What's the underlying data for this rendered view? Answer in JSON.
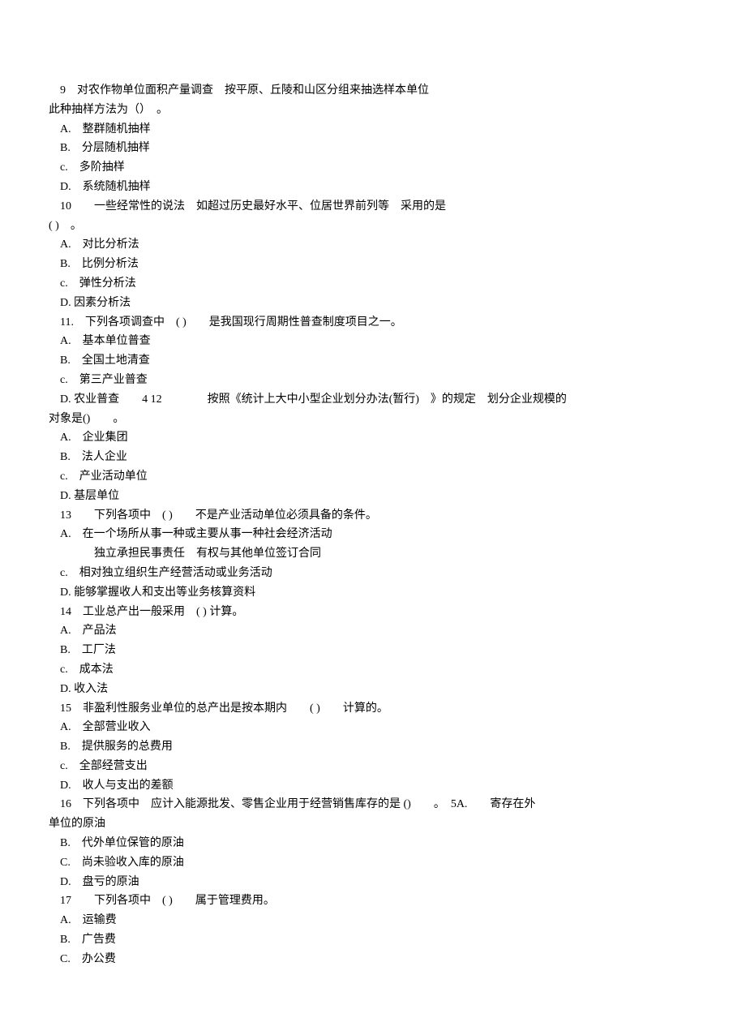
{
  "questions": [
    {
      "num": "9",
      "text": "对农作物单位面积产量调查　按平原、丘陵和山区分组来抽选样本单位",
      "text2": "此种抽样方法为（）　。",
      "options": [
        "A.　整群随机抽样",
        "B.　分层随机抽样",
        "c.　多阶抽样",
        "D.　系统随机抽样"
      ]
    },
    {
      "num": "10",
      "text": "　　一些经常性的说法　如超过历史最好水平、位居世界前列等　采用的是",
      "text2": "( )　。",
      "options": [
        "A.　对比分析法",
        "B.　比例分析法",
        "c.　弹性分析法",
        "D. 因素分析法"
      ]
    },
    {
      "num": "11.",
      "text": "　下列各项调查中　( )　　是我国现行周期性普查制度项目之一。",
      "options": [
        "A.　基本单位普查",
        "B.　全国土地清查",
        "c.　第三产业普查"
      ],
      "lastOption": "D. 农业普查　　4 12　　　　按照《统计上大中小型企业划分办法(暂行)　》的规定　划分企业规模的",
      "text3": "对象是()　　。",
      "options2": [
        "A.　企业集团",
        "B.　法人企业",
        "c.　产业活动单位",
        "D. 基层单位"
      ]
    },
    {
      "num": "13",
      "text": "　　下列各项中　( )　　不是产业活动单位必须具备的条件。",
      "options": [
        "A.　在一个场所从事一种或主要从事一种社会经济活动",
        "　　　独立承担民事责任　有权与其他单位签订合同",
        "c.　相对独立组织生产经营活动或业务活动",
        "D. 能够掌握收人和支出等业务核算资料"
      ]
    },
    {
      "num": "14",
      "text": "工业总产出一般采用　( ) 计算。",
      "options": [
        "A.　产品法",
        "B.　工厂法",
        "c.　成本法",
        "D. 收入法"
      ]
    },
    {
      "num": "15",
      "text": "非盈利性服务业单位的总产出是按本期内　　( )　　计算的。",
      "options": [
        "A.　全部营业收入",
        "B.　提供服务的总费用",
        "c.　全部经营支出",
        "D.　收人与支出的差额"
      ]
    },
    {
      "num": "16",
      "text": "　下列各项中　应计入能源批发、零售企业用于经营销售库存的是 ()　　。　5A.　　寄存在外",
      "text2": "单位的原油",
      "options": [
        "B.　代外单位保管的原油",
        "C.　尚未验收入库的原油",
        "D.　盘亏的原油"
      ]
    },
    {
      "num": "17",
      "text": "　　下列各项中　( )　　属于管理费用。",
      "options": [
        "A.　运输费",
        "B.　广告费",
        "C.　办公费"
      ]
    }
  ]
}
